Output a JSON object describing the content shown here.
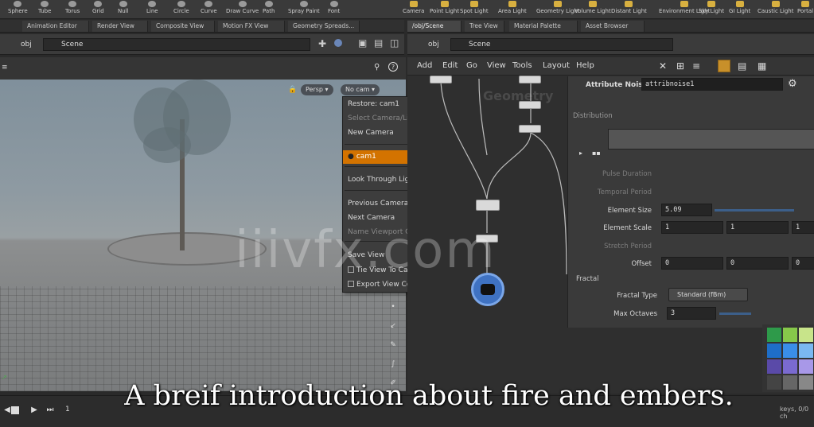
{
  "shelf": {
    "tools": [
      "Sphere",
      "Tube",
      "Torus",
      "Grid",
      "Null",
      "Line",
      "Circle",
      "Curve",
      "Draw Curve",
      "Path",
      "Spray Paint",
      "Font"
    ],
    "light_tools": [
      "Camera",
      "Point Light",
      "Spot Light",
      "Area Light",
      "Geometry Light",
      "Volume Light",
      "Distant Light",
      "Environment Light",
      "Sky Light",
      "GI Light",
      "Caustic Light",
      "Portal"
    ]
  },
  "left_tabs": [
    "Animation Editor",
    "Render View",
    "Composite View",
    "Motion FX View",
    "Geometry Spreads..."
  ],
  "right_tabs": [
    "/obj/Scene",
    "Tree View",
    "Material Palette",
    "Asset Browser"
  ],
  "left_path": {
    "root": "obj",
    "current": "Scene"
  },
  "right_path": {
    "root": "obj",
    "current": "Scene"
  },
  "viewport": {
    "persp_label": "Persp ▾",
    "cam_label": "No cam ▾"
  },
  "camera_menu": {
    "items": [
      {
        "label": "Restore: cam1",
        "state": "normal"
      },
      {
        "label": "Select Camera/Light",
        "state": "disabled"
      },
      {
        "label": "New Camera",
        "state": "normal"
      },
      {
        "label": "cam1",
        "state": "highlighted"
      },
      {
        "label": "Look Through Light",
        "state": "normal"
      },
      {
        "label": "Previous Camera",
        "state": "normal"
      },
      {
        "label": "Next Camera",
        "state": "normal"
      },
      {
        "label": "Name Viewport Camera",
        "state": "disabled"
      },
      {
        "label": "Save View",
        "state": "normal"
      },
      {
        "label": "Tie View To Camera/Light",
        "state": "checkbox"
      },
      {
        "label": "Export View Continuously",
        "state": "checkbox"
      }
    ]
  },
  "network_menu": [
    "Add",
    "Edit",
    "Go",
    "View",
    "Tools",
    "Layout",
    "Help"
  ],
  "network": {
    "watermark_label": "Geometry"
  },
  "params": {
    "node_type": "Attribute Noise",
    "node_name": "attribnoise1",
    "section_distribution": "Distribution",
    "pulse_duration": "Pulse Duration",
    "temporal_period": "Temporal Period",
    "element_size_label": "Element Size",
    "element_size": "5.09",
    "element_scale_label": "Element Scale",
    "element_scale": [
      "1",
      "1",
      "1"
    ],
    "stretch_period": "Stretch Period",
    "offset_label": "Offset",
    "offset": [
      "0",
      "0",
      "0"
    ],
    "section_fractal": "Fractal",
    "fractal_type_label": "Fractal Type",
    "fractal_type": "Standard (fBm)",
    "max_octaves_label": "Max Octaves",
    "max_octaves": "3"
  },
  "timeline": {
    "frame": "1",
    "right_text": "keys, 0/0 ch"
  },
  "watermark": "iiivfx.com",
  "subtitle": "A breif introduction about fire and embers."
}
